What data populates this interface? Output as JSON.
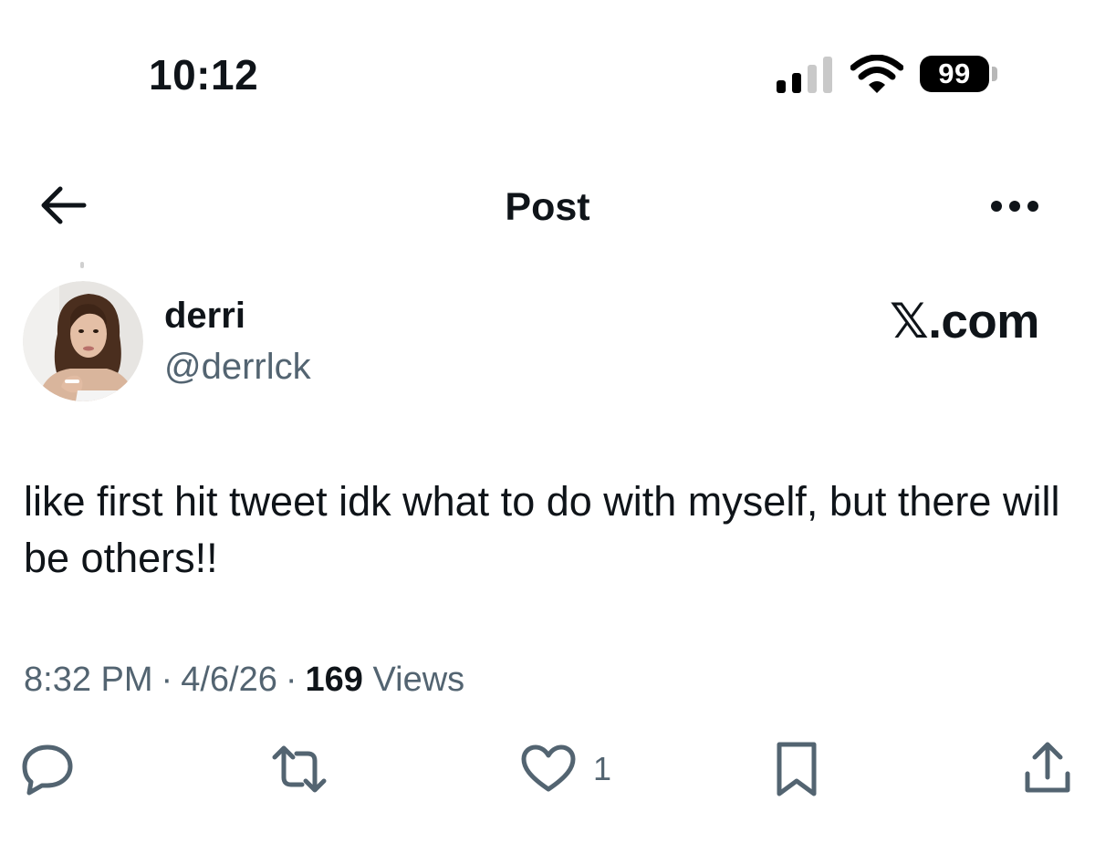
{
  "status_bar": {
    "time": "10:12",
    "battery_level": "99"
  },
  "header": {
    "title": "Post"
  },
  "post": {
    "author_name": "derri",
    "author_handle": "@derrlck",
    "watermark": "𝕏.com",
    "text": "like first hit tweet idk what to do with myself, but there will be others!!",
    "time": "8:32 PM",
    "separator": "·",
    "date": "4/6/26",
    "views_count": "169",
    "views_label": "Views",
    "like_count": "1"
  },
  "colors": {
    "primary_text": "#0f1419",
    "secondary_text": "#536471",
    "background": "#ffffff"
  },
  "icons": [
    "back-arrow-icon",
    "more-icon",
    "reply-icon",
    "retweet-icon",
    "like-icon",
    "bookmark-icon",
    "share-icon",
    "signal-icon",
    "wifi-icon",
    "battery-icon"
  ]
}
